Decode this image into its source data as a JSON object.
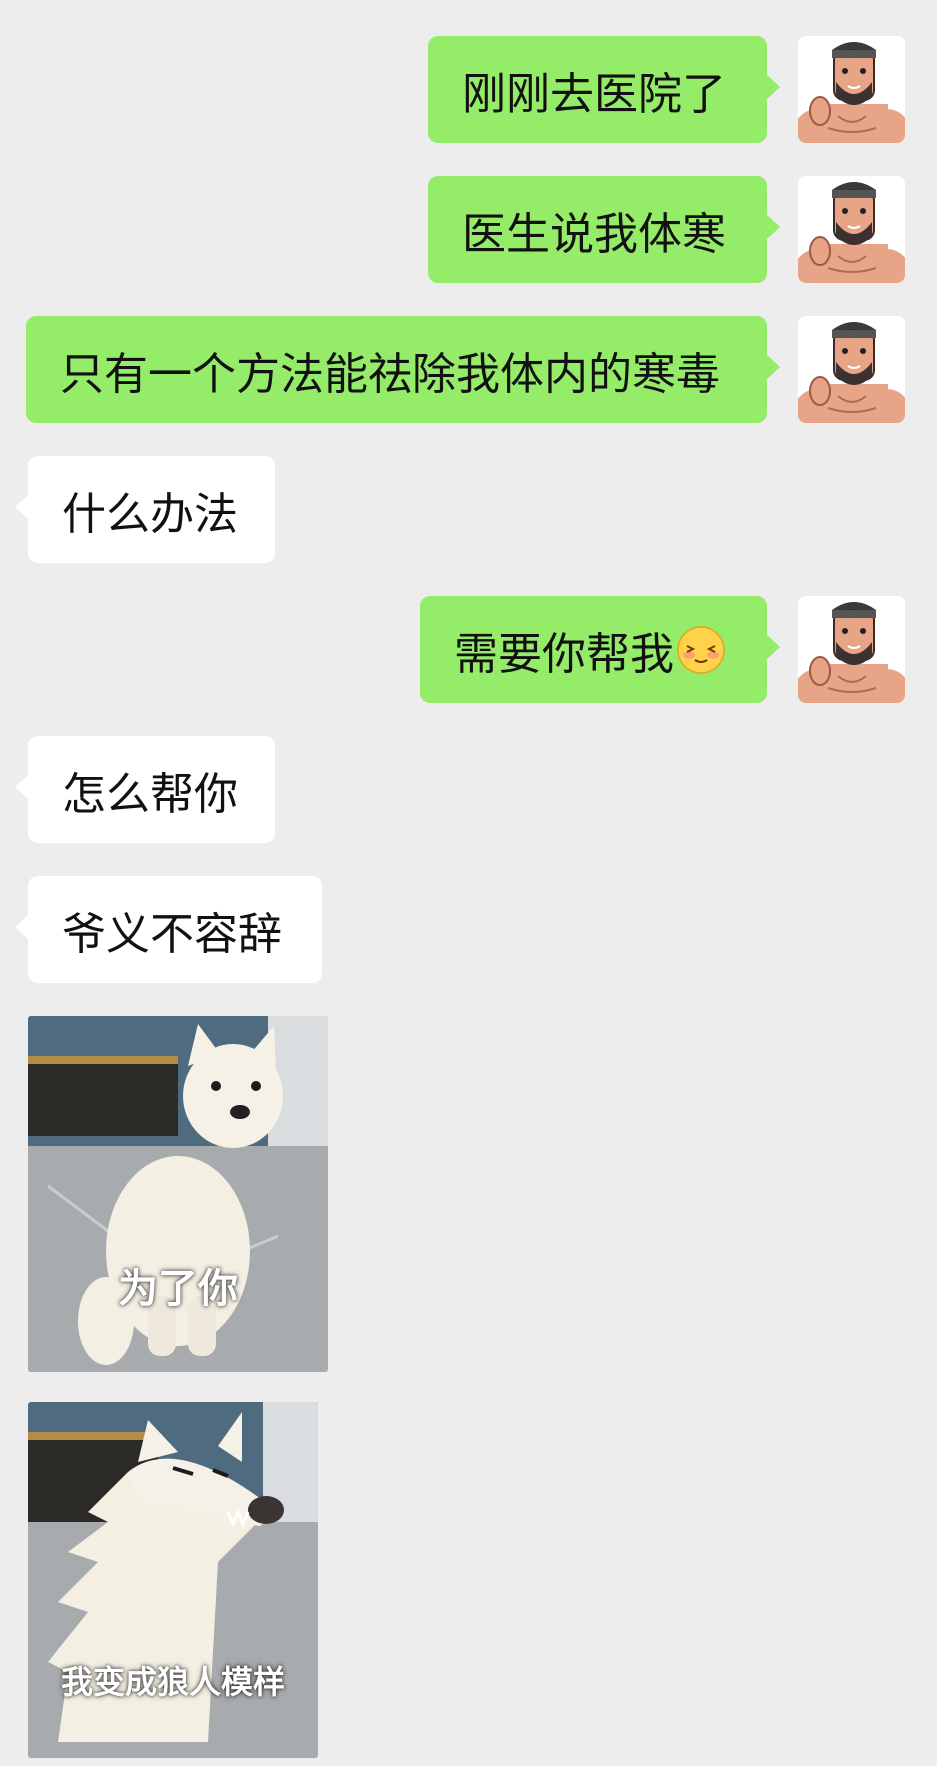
{
  "messages": [
    {
      "side": "me",
      "text": "刚刚去医院了"
    },
    {
      "side": "me",
      "text": "医生说我体寒"
    },
    {
      "side": "me",
      "text": "只有一个方法能祛除我体内的寒毒"
    },
    {
      "side": "other",
      "text": "什么办法"
    },
    {
      "side": "me",
      "text": "需要你帮我",
      "emoji": "shy-smile-emoji"
    },
    {
      "side": "other",
      "text": "怎么帮你"
    },
    {
      "side": "other",
      "text": "爷义不容辞"
    },
    {
      "side": "other",
      "sticker": "white-dog-sitting",
      "caption": "为了你"
    },
    {
      "side": "other",
      "sticker": "white-dog-werewolf",
      "caption": "我变成狼人模样"
    }
  ],
  "colors": {
    "background": "#ededed",
    "my_bubble": "#95ec69",
    "their_bubble": "#ffffff"
  },
  "icons": {
    "avatar": "cartoon-muscle-man-avatar"
  }
}
